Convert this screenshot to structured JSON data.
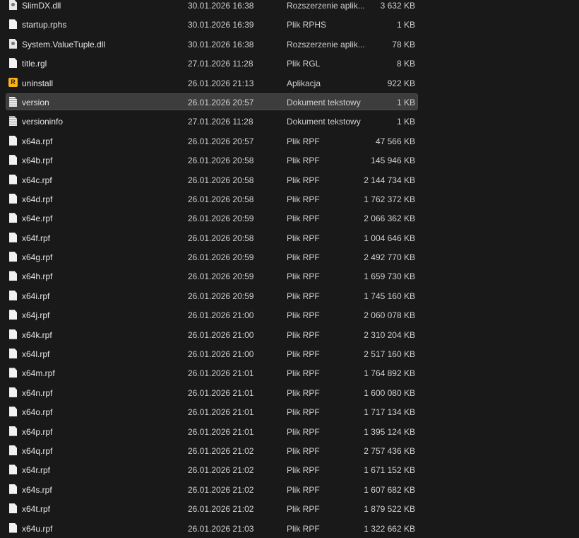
{
  "files": [
    {
      "name": "SlimDX.dll",
      "date": "30.01.2026 16:38",
      "type": "Rozszerzenie aplik...",
      "size": "3 632 KB",
      "icon": "dll"
    },
    {
      "name": "startup.rphs",
      "date": "30.01.2026 16:39",
      "type": "Plik RPHS",
      "size": "1 KB",
      "icon": "file"
    },
    {
      "name": "System.ValueTuple.dll",
      "date": "30.01.2026 16:38",
      "type": "Rozszerzenie aplik...",
      "size": "78 KB",
      "icon": "dll"
    },
    {
      "name": "title.rgl",
      "date": "27.01.2026 11:28",
      "type": "Plik RGL",
      "size": "8 KB",
      "icon": "file"
    },
    {
      "name": "uninstall",
      "date": "26.01.2026 21:13",
      "type": "Aplikacja",
      "size": "922 KB",
      "icon": "app"
    },
    {
      "name": "version",
      "date": "26.01.2026 20:57",
      "type": "Dokument tekstowy",
      "size": "1 KB",
      "icon": "txt",
      "selected": true
    },
    {
      "name": "versioninfo",
      "date": "27.01.2026 11:28",
      "type": "Dokument tekstowy",
      "size": "1 KB",
      "icon": "txt"
    },
    {
      "name": "x64a.rpf",
      "date": "26.01.2026 20:57",
      "type": "Plik RPF",
      "size": "47 566 KB",
      "icon": "file"
    },
    {
      "name": "x64b.rpf",
      "date": "26.01.2026 20:58",
      "type": "Plik RPF",
      "size": "145 946 KB",
      "icon": "file"
    },
    {
      "name": "x64c.rpf",
      "date": "26.01.2026 20:58",
      "type": "Plik RPF",
      "size": "2 144 734 KB",
      "icon": "file"
    },
    {
      "name": "x64d.rpf",
      "date": "26.01.2026 20:58",
      "type": "Plik RPF",
      "size": "1 762 372 KB",
      "icon": "file"
    },
    {
      "name": "x64e.rpf",
      "date": "26.01.2026 20:59",
      "type": "Plik RPF",
      "size": "2 066 362 KB",
      "icon": "file"
    },
    {
      "name": "x64f.rpf",
      "date": "26.01.2026 20:58",
      "type": "Plik RPF",
      "size": "1 004 646 KB",
      "icon": "file"
    },
    {
      "name": "x64g.rpf",
      "date": "26.01.2026 20:59",
      "type": "Plik RPF",
      "size": "2 492 770 KB",
      "icon": "file"
    },
    {
      "name": "x64h.rpf",
      "date": "26.01.2026 20:59",
      "type": "Plik RPF",
      "size": "1 659 730 KB",
      "icon": "file"
    },
    {
      "name": "x64i.rpf",
      "date": "26.01.2026 20:59",
      "type": "Plik RPF",
      "size": "1 745 160 KB",
      "icon": "file"
    },
    {
      "name": "x64j.rpf",
      "date": "26.01.2026 21:00",
      "type": "Plik RPF",
      "size": "2 060 078 KB",
      "icon": "file"
    },
    {
      "name": "x64k.rpf",
      "date": "26.01.2026 21:00",
      "type": "Plik RPF",
      "size": "2 310 204 KB",
      "icon": "file"
    },
    {
      "name": "x64l.rpf",
      "date": "26.01.2026 21:00",
      "type": "Plik RPF",
      "size": "2 517 160 KB",
      "icon": "file"
    },
    {
      "name": "x64m.rpf",
      "date": "26.01.2026 21:01",
      "type": "Plik RPF",
      "size": "1 764 892 KB",
      "icon": "file"
    },
    {
      "name": "x64n.rpf",
      "date": "26.01.2026 21:01",
      "type": "Plik RPF",
      "size": "1 600 080 KB",
      "icon": "file"
    },
    {
      "name": "x64o.rpf",
      "date": "26.01.2026 21:01",
      "type": "Plik RPF",
      "size": "1 717 134 KB",
      "icon": "file"
    },
    {
      "name": "x64p.rpf",
      "date": "26.01.2026 21:01",
      "type": "Plik RPF",
      "size": "1 395 124 KB",
      "icon": "file"
    },
    {
      "name": "x64q.rpf",
      "date": "26.01.2026 21:02",
      "type": "Plik RPF",
      "size": "2 757 436 KB",
      "icon": "file"
    },
    {
      "name": "x64r.rpf",
      "date": "26.01.2026 21:02",
      "type": "Plik RPF",
      "size": "1 671 152 KB",
      "icon": "file"
    },
    {
      "name": "x64s.rpf",
      "date": "26.01.2026 21:02",
      "type": "Plik RPF",
      "size": "1 607 682 KB",
      "icon": "file"
    },
    {
      "name": "x64t.rpf",
      "date": "26.01.2026 21:02",
      "type": "Plik RPF",
      "size": "1 879 522 KB",
      "icon": "file"
    },
    {
      "name": "x64u.rpf",
      "date": "26.01.2026 21:03",
      "type": "Plik RPF",
      "size": "1 322 662 KB",
      "icon": "file"
    }
  ],
  "app_icon_glyph": "R"
}
